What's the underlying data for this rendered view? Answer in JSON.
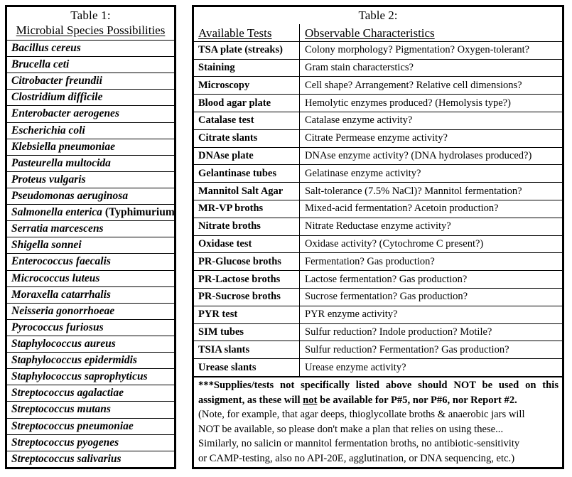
{
  "table1": {
    "title": "Table 1:",
    "subtitle": "Microbial Species Possibilities",
    "species": [
      {
        "name": "Bacillus cereus"
      },
      {
        "name": "Brucella ceti"
      },
      {
        "name": "Citrobacter freundii"
      },
      {
        "name": "Clostridium difficile"
      },
      {
        "name": "Enterobacter aerogenes"
      },
      {
        "name": "Escherichia coli"
      },
      {
        "name": "Klebsiella pneumoniae"
      },
      {
        "name": "Pasteurella multocida"
      },
      {
        "name": "Proteus vulgaris"
      },
      {
        "name": "Pseudomonas aeruginosa"
      },
      {
        "name": "Salmonella enterica",
        "strain": "(Typhimurium)"
      },
      {
        "name": "Serratia marcescens"
      },
      {
        "name": "Shigella sonnei"
      },
      {
        "name": "Enterococcus faecalis"
      },
      {
        "name": "Micrococcus luteus"
      },
      {
        "name": "Moraxella catarrhalis"
      },
      {
        "name": "Neisseria gonorrhoeae"
      },
      {
        "name": "Pyrococcus furiosus"
      },
      {
        "name": "Staphylococcus aureus"
      },
      {
        "name": "Staphylococcus epidermidis"
      },
      {
        "name": "Staphylococcus saprophyticus"
      },
      {
        "name": "Streptococcus agalactiae"
      },
      {
        "name": "Streptococcus mutans"
      },
      {
        "name": "Streptococcus pneumoniae"
      },
      {
        "name": "Streptococcus pyogenes"
      },
      {
        "name": "Streptococcus salivarius"
      }
    ]
  },
  "table2": {
    "title": "Table 2:",
    "headers": {
      "tests": "Available Tests",
      "characteristics": "Observable Characteristics"
    },
    "rows": [
      {
        "test": "TSA plate (streaks)",
        "characteristic": "Colony morphology? Pigmentation? Oxygen-tolerant?"
      },
      {
        "test": "Staining",
        "characteristic": "Gram stain characterstics?"
      },
      {
        "test": "Microscopy",
        "characteristic": "Cell shape? Arrangement? Relative cell dimensions?"
      },
      {
        "test": "Blood agar plate",
        "characteristic": "Hemolytic enzymes produced? (Hemolysis type?)"
      },
      {
        "test": "Catalase test",
        "characteristic": "Catalase enzyme activity?"
      },
      {
        "test": "Citrate slants",
        "characteristic": "Citrate Permease enzyme activity?"
      },
      {
        "test": "DNAse plate",
        "characteristic": "DNAse enzyme activity? (DNA hydrolases produced?)"
      },
      {
        "test": "Gelantinase tubes",
        "characteristic": "Gelatinase enzyme activity?"
      },
      {
        "test": "Mannitol Salt Agar",
        "characteristic": "Salt-tolerance (7.5% NaCl)? Mannitol fermentation?"
      },
      {
        "test": "MR-VP broths",
        "characteristic": "Mixed-acid fermentation? Acetoin production?"
      },
      {
        "test": "Nitrate broths",
        "characteristic": "Nitrate Reductase enzyme activity?"
      },
      {
        "test": "Oxidase test",
        "characteristic": "Oxidase activity? (Cytochrome C present?)"
      },
      {
        "test": "PR-Glucose broths",
        "characteristic": "Fermentation? Gas production?"
      },
      {
        "test": "PR-Lactose broths",
        "characteristic": "Lactose fermentation? Gas production?"
      },
      {
        "test": "PR-Sucrose broths",
        "characteristic": "Sucrose fermentation? Gas production?"
      },
      {
        "test": "PYR test",
        "characteristic": "PYR enzyme activity?"
      },
      {
        "test": "SIM tubes",
        "characteristic": "Sulfur reduction? Indole production? Motile?"
      },
      {
        "test": "TSIA slants",
        "characteristic": "Sulfur reduction? Fermentation? Gas production?"
      },
      {
        "test": "Urease slants",
        "characteristic": "Urease enzyme activity?"
      }
    ],
    "notes": {
      "bold_part1": "***Supplies/tests not specifically listed above should NOT be used on this assigment, as these will ",
      "bold_underlined": "not",
      "bold_part2": " be available for P#5, nor P#6, nor Report #2.",
      "plain_line1": "(Note, for example, that agar deeps, thioglycollate broths & anaerobic jars will",
      "plain_line2": "NOT be available, so please don't make a plan that relies on using these...",
      "plain_line3": "Similarly, no salicin or mannitol fermentation broths, no antibiotic-sensitivity",
      "plain_line4": "or CAMP-testing, also no API-20E, agglutination, or DNA sequencing, etc.)"
    }
  }
}
